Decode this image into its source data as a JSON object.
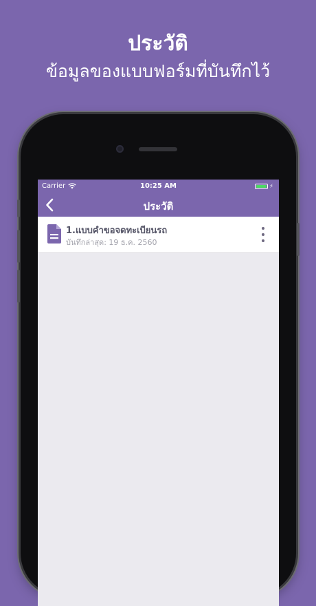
{
  "promo": {
    "title": "ประวัติ",
    "subtitle": "ข้อมูลของแบบฟอร์มที่บันทึกไว้"
  },
  "status_bar": {
    "carrier": "Carrier",
    "time": "10:25 AM",
    "wifi_icon": "wifi-icon",
    "battery_icon": "battery-charging-icon"
  },
  "nav": {
    "title": "ประวัติ",
    "back_icon": "chevron-left-icon"
  },
  "history": {
    "items": [
      {
        "title": "1.แบบคำขอจดทะเบียนรถ",
        "subtitle": "บันทึกล่าสุด: 19 ธ.ค. 2560",
        "icon": "document-icon",
        "menu_icon": "more-vertical-icon"
      }
    ]
  },
  "colors": {
    "brand": "#7b66ad",
    "background": "#ebeaef",
    "battery": "#4cd964"
  }
}
